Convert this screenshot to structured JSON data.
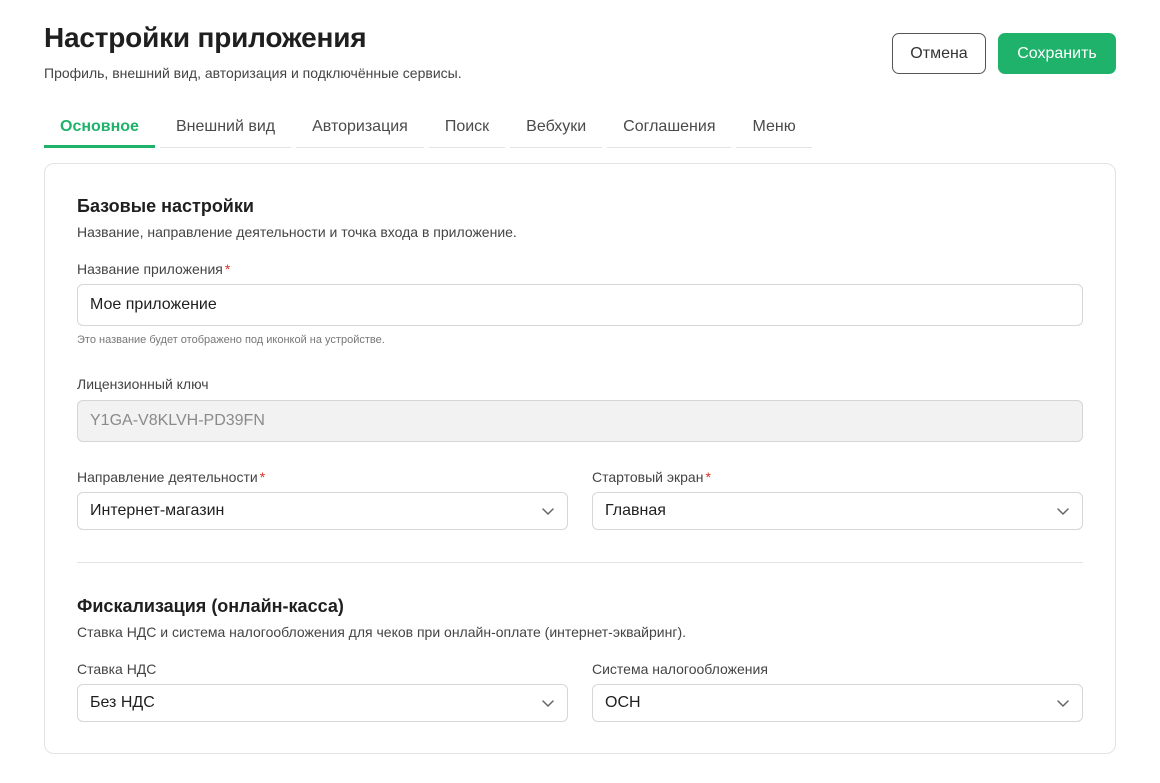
{
  "header": {
    "title": "Настройки приложения",
    "subtitle": "Профиль, внешний вид, авторизация и подключённые сервисы.",
    "cancel_label": "Отмена",
    "save_label": "Сохранить"
  },
  "tabs": [
    {
      "label": "Основное",
      "active": true
    },
    {
      "label": "Внешний вид"
    },
    {
      "label": "Авторизация"
    },
    {
      "label": "Поиск"
    },
    {
      "label": "Вебхуки"
    },
    {
      "label": "Соглашения"
    },
    {
      "label": "Меню"
    }
  ],
  "basic": {
    "title": "Базовые настройки",
    "desc": "Название, направление деятельности и точка входа в приложение.",
    "app_name_label": "Название приложения",
    "app_name_value": "Мое приложение",
    "app_name_hint": "Это название будет отображено под иконкой на устройстве.",
    "license_label": "Лицензионный ключ",
    "license_value": "Y1GA-V8KLVH-PD39FN",
    "activity_label": "Направление деятельности",
    "activity_value": "Интернет-магазин",
    "start_label": "Стартовый экран",
    "start_value": "Главная",
    "required_mark": "*"
  },
  "fiscal": {
    "title": "Фискализация (онлайн-касса)",
    "desc": "Ставка НДС и система налогообложения для чеков при онлайн-оплате (интернет-эквайринг).",
    "vat_label": "Ставка НДС",
    "vat_value": "Без НДС",
    "tax_label": "Система налогообложения",
    "tax_value": "ОСН"
  },
  "colors": {
    "accent": "#1fb26a",
    "required": "#d93025"
  }
}
